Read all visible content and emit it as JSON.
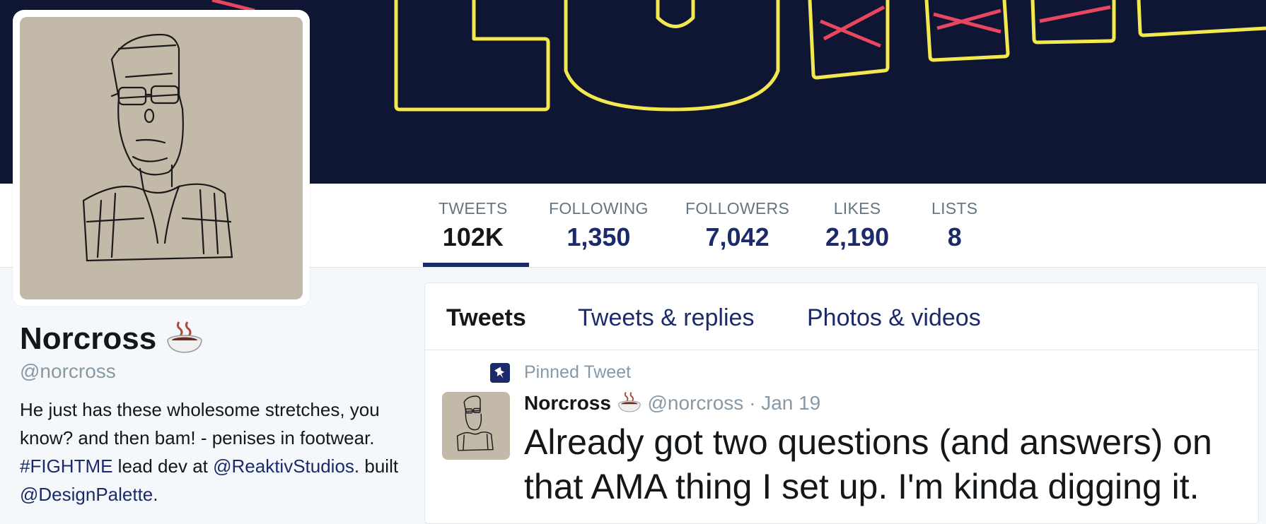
{
  "profile": {
    "name": "Norcross",
    "handle": "@norcross",
    "bio_text_1": "He just has these wholesome stretches, you know? and then bam! - penises in footwear. ",
    "bio_hashtag": "#FIGHTME",
    "bio_text_2": " lead dev at ",
    "bio_mention_1": "@ReaktivStudios",
    "bio_text_3": ". built ",
    "bio_mention_2": "@DesignPalette",
    "bio_text_4": "."
  },
  "stats": [
    {
      "label": "TWEETS",
      "value": "102K"
    },
    {
      "label": "FOLLOWING",
      "value": "1,350"
    },
    {
      "label": "FOLLOWERS",
      "value": "7,042"
    },
    {
      "label": "LIKES",
      "value": "2,190"
    },
    {
      "label": "LISTS",
      "value": "8"
    }
  ],
  "tabs": [
    {
      "label": "Tweets"
    },
    {
      "label": "Tweets & replies"
    },
    {
      "label": "Photos & videos"
    }
  ],
  "tweet": {
    "pinned_label": "Pinned Tweet",
    "author": "Norcross",
    "handle": "@norcross",
    "separator": "·",
    "date": "Jan 19",
    "text": "Already got two questions (and answers) on that AMA thing I set up. I'm kinda digging it."
  },
  "colors": {
    "accent": "#1b2a6b",
    "banner_bg": "#0f1634",
    "banner_outline": "#f2e94e",
    "banner_stripe": "#e8475f",
    "avatar_bg": "#c2b9a8"
  },
  "icons": {
    "emoji": "hot-beverage-icon",
    "pin": "pin-icon"
  }
}
